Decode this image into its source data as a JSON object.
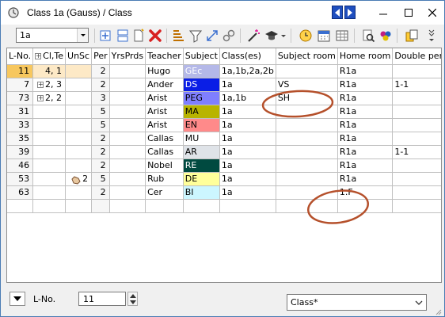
{
  "window": {
    "title": "Class 1a (Gauss) / Class",
    "minimize_icon": "minimize-icon",
    "maximize_icon": "maximize-icon",
    "close_icon": "close-icon"
  },
  "toolbar": {
    "class_selector": "1a",
    "icons": [
      "new-lesson-icon",
      "split-icon",
      "new-document-icon",
      "delete-icon",
      "lesson-sequence-icon",
      "filter-icon",
      "resize-icon",
      "link-icon",
      "magic-wand-icon",
      "graduation-cap-icon",
      "clock-icon",
      "calendar-icon",
      "print-preview-icon",
      "print-icon",
      "color-icon",
      "export-icon",
      "more-icon"
    ]
  },
  "grid": {
    "headers": [
      "L-No.",
      "Cl,Te",
      "UnSc",
      "Per",
      "YrsPrds",
      "Teacher",
      "Subject",
      "Class(es)",
      "Subject room",
      "Home room",
      "Double pers"
    ],
    "rows": [
      {
        "lno": "11",
        "clte": "4, 1",
        "unsc": "",
        "per": "2",
        "yrs": "",
        "teacher": "Hugo",
        "subject": "GEc",
        "subj_color": "#b4b8e8",
        "classes": "1a,1b,2a,2b",
        "subject_room": "",
        "home_room": "R1a",
        "double": ""
      },
      {
        "lno": "7",
        "clte": "2, 3",
        "unsc": "",
        "per": "2",
        "yrs": "",
        "teacher": "Ander",
        "subject": "DS",
        "subj_color": "#0a1ee6",
        "classes": "1a",
        "subject_room": "VS",
        "home_room": "R1a",
        "double": "1-1"
      },
      {
        "lno": "73",
        "clte": "2, 2",
        "unsc": "",
        "per": "3",
        "yrs": "",
        "teacher": "Arist",
        "subject": "PEG",
        "subj_color": "#7f7fff",
        "classes": "1a,1b",
        "subject_room": "SH",
        "home_room": "R1a",
        "double": ""
      },
      {
        "lno": "31",
        "clte": "",
        "unsc": "",
        "per": "5",
        "yrs": "",
        "teacher": "Arist",
        "subject": "MA",
        "subj_color": "#b8b400",
        "classes": "1a",
        "subject_room": "",
        "home_room": "R1a",
        "double": ""
      },
      {
        "lno": "33",
        "clte": "",
        "unsc": "",
        "per": "5",
        "yrs": "",
        "teacher": "Arist",
        "subject": "EN",
        "subj_color": "#ff8a8a",
        "classes": "1a",
        "subject_room": "",
        "home_room": "R1a",
        "double": ""
      },
      {
        "lno": "35",
        "clte": "",
        "unsc": "",
        "per": "2",
        "yrs": "",
        "teacher": "Callas",
        "subject": "MU",
        "subj_color": "#ffffff",
        "classes": "1a",
        "subject_room": "",
        "home_room": "R1a",
        "double": ""
      },
      {
        "lno": "39",
        "clte": "",
        "unsc": "",
        "per": "2",
        "yrs": "",
        "teacher": "Callas",
        "subject": "AR",
        "subj_color": "#dfe3e8",
        "classes": "1a",
        "subject_room": "",
        "home_room": "R1a",
        "double": "1-1"
      },
      {
        "lno": "46",
        "clte": "",
        "unsc": "",
        "per": "2",
        "yrs": "",
        "teacher": "Nobel",
        "subject": "RE",
        "subj_color": "#004a40",
        "classes": "1a",
        "subject_room": "",
        "home_room": "R1a",
        "double": ""
      },
      {
        "lno": "53",
        "clte": "",
        "unsc": "2",
        "per": "5",
        "yrs": "",
        "teacher": "Rub",
        "subject": "DE",
        "subj_color": "#ffff9a",
        "classes": "1a",
        "subject_room": "",
        "home_room": "R1a",
        "double": ""
      },
      {
        "lno": "63",
        "clte": "",
        "unsc": "",
        "per": "2",
        "yrs": "",
        "teacher": "Cer",
        "subject": "BI",
        "subj_color": "#ccf6ff",
        "classes": "1a",
        "subject_room": "",
        "home_room": "1.F",
        "double": ""
      }
    ]
  },
  "bottom": {
    "field_label": "L-No.",
    "field_value": "11",
    "filter_value": "Class*"
  }
}
